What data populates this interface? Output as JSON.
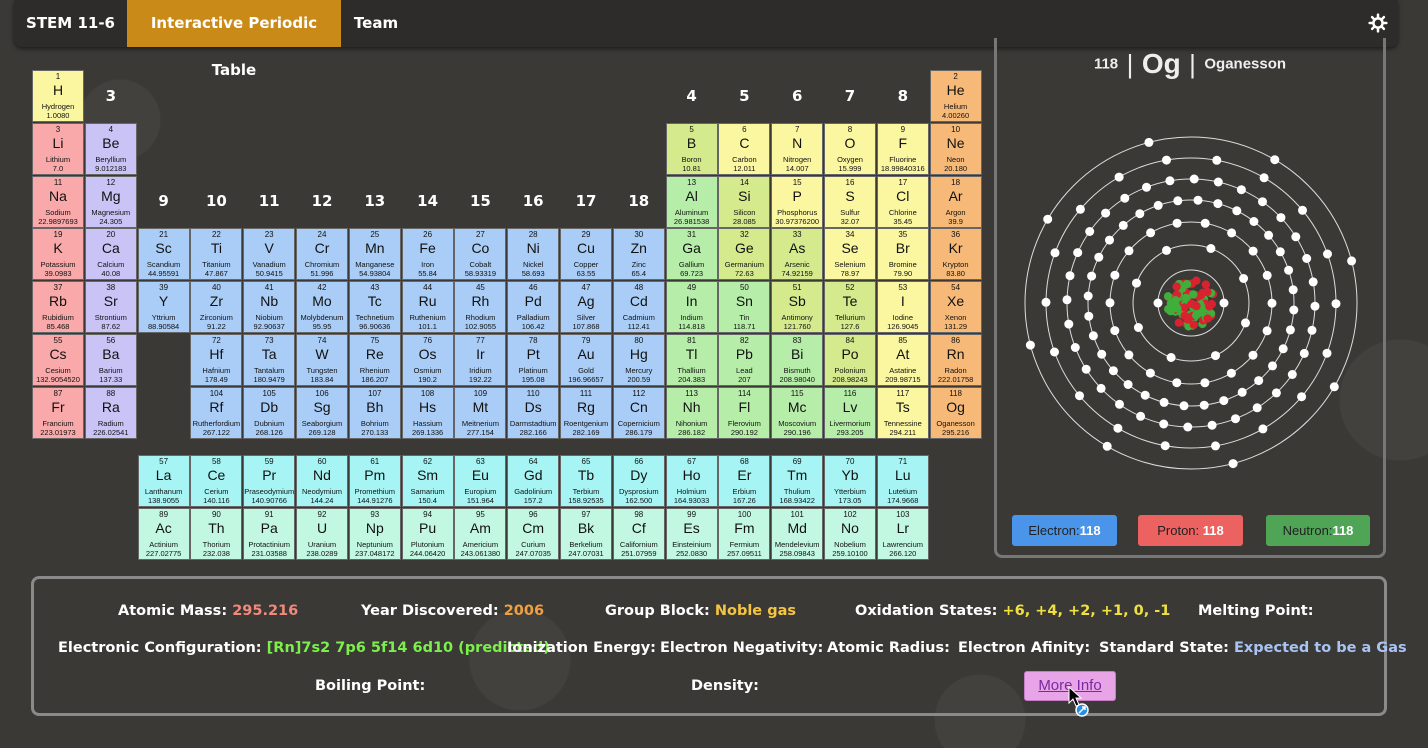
{
  "nav": {
    "items": [
      "STEM 11-6",
      "Interactive Periodic Table",
      "Team"
    ],
    "active_index": 1,
    "settings_icon": "gear-icon"
  },
  "group_labels": [
    {
      "label": "3"
    },
    {
      "label": "4"
    },
    {
      "label": "5"
    },
    {
      "label": "6"
    },
    {
      "label": "7"
    },
    {
      "label": "8"
    },
    {
      "label": "9"
    },
    {
      "label": "10"
    },
    {
      "label": "11"
    },
    {
      "label": "12"
    },
    {
      "label": "13"
    },
    {
      "label": "14"
    },
    {
      "label": "15"
    },
    {
      "label": "16"
    },
    {
      "label": "17"
    },
    {
      "label": "18"
    }
  ],
  "colors": {
    "alkali": "#f9a9a9",
    "alkaline": "#c9c3f6",
    "transition": "#a9cdf6",
    "post": "#b6eea9",
    "metalloid": "#d5e98d",
    "nonmetal": "#fbf6a0",
    "noble": "#f7b977",
    "hydrogen": "#fbf6a0",
    "lanthanide": "#a6f5f4",
    "actinide": "#c2f7e2",
    "unknown": "#cfe9a5"
  },
  "elements": [
    {
      "n": "1",
      "s": "H",
      "name": "Hydrogen",
      "m": "1.0080",
      "c": "hydrogen"
    },
    {
      "n": "2",
      "s": "He",
      "name": "Helium",
      "m": "4.00260",
      "c": "noble"
    },
    {
      "n": "3",
      "s": "Li",
      "name": "Lithium",
      "m": "7.0",
      "c": "alkali"
    },
    {
      "n": "4",
      "s": "Be",
      "name": "Beryllium",
      "m": "9.012183",
      "c": "alkaline"
    },
    {
      "n": "5",
      "s": "B",
      "name": "Boron",
      "m": "10.81",
      "c": "metalloid"
    },
    {
      "n": "6",
      "s": "C",
      "name": "Carbon",
      "m": "12.011",
      "c": "nonmetal"
    },
    {
      "n": "7",
      "s": "N",
      "name": "Nitrogen",
      "m": "14.007",
      "c": "nonmetal"
    },
    {
      "n": "8",
      "s": "O",
      "name": "Oxygen",
      "m": "15.999",
      "c": "nonmetal"
    },
    {
      "n": "9",
      "s": "F",
      "name": "Fluorine",
      "m": "18.99840316",
      "c": "nonmetal"
    },
    {
      "n": "10",
      "s": "Ne",
      "name": "Neon",
      "m": "20.180",
      "c": "noble"
    },
    {
      "n": "11",
      "s": "Na",
      "name": "Sodium",
      "m": "22.9897693",
      "c": "alkali"
    },
    {
      "n": "12",
      "s": "Mg",
      "name": "Magnesium",
      "m": "24.305",
      "c": "alkaline"
    },
    {
      "n": "13",
      "s": "Al",
      "name": "Aluminum",
      "m": "26.981538",
      "c": "post"
    },
    {
      "n": "14",
      "s": "Si",
      "name": "Silicon",
      "m": "28.085",
      "c": "metalloid"
    },
    {
      "n": "15",
      "s": "P",
      "name": "Phosphorus",
      "m": "30.97376200",
      "c": "nonmetal"
    },
    {
      "n": "16",
      "s": "S",
      "name": "Sulfur",
      "m": "32.07",
      "c": "nonmetal"
    },
    {
      "n": "17",
      "s": "Cl",
      "name": "Chlorine",
      "m": "35.45",
      "c": "nonmetal"
    },
    {
      "n": "18",
      "s": "Ar",
      "name": "Argon",
      "m": "39.9",
      "c": "noble"
    },
    {
      "n": "19",
      "s": "K",
      "name": "Potassium",
      "m": "39.0983",
      "c": "alkali"
    },
    {
      "n": "20",
      "s": "Ca",
      "name": "Calcium",
      "m": "40.08",
      "c": "alkaline"
    },
    {
      "n": "21",
      "s": "Sc",
      "name": "Scandium",
      "m": "44.95591",
      "c": "transition"
    },
    {
      "n": "22",
      "s": "Ti",
      "name": "Titanium",
      "m": "47.867",
      "c": "transition"
    },
    {
      "n": "23",
      "s": "V",
      "name": "Vanadium",
      "m": "50.9415",
      "c": "transition"
    },
    {
      "n": "24",
      "s": "Cr",
      "name": "Chromium",
      "m": "51.996",
      "c": "transition"
    },
    {
      "n": "25",
      "s": "Mn",
      "name": "Manganese",
      "m": "54.93804",
      "c": "transition"
    },
    {
      "n": "26",
      "s": "Fe",
      "name": "Iron",
      "m": "55.84",
      "c": "transition"
    },
    {
      "n": "27",
      "s": "Co",
      "name": "Cobalt",
      "m": "58.93319",
      "c": "transition"
    },
    {
      "n": "28",
      "s": "Ni",
      "name": "Nickel",
      "m": "58.693",
      "c": "transition"
    },
    {
      "n": "29",
      "s": "Cu",
      "name": "Copper",
      "m": "63.55",
      "c": "transition"
    },
    {
      "n": "30",
      "s": "Zn",
      "name": "Zinc",
      "m": "65.4",
      "c": "transition"
    },
    {
      "n": "31",
      "s": "Ga",
      "name": "Gallium",
      "m": "69.723",
      "c": "post"
    },
    {
      "n": "32",
      "s": "Ge",
      "name": "Germanium",
      "m": "72.63",
      "c": "metalloid"
    },
    {
      "n": "33",
      "s": "As",
      "name": "Arsenic",
      "m": "74.92159",
      "c": "metalloid"
    },
    {
      "n": "34",
      "s": "Se",
      "name": "Selenium",
      "m": "78.97",
      "c": "nonmetal"
    },
    {
      "n": "35",
      "s": "Br",
      "name": "Bromine",
      "m": "79.90",
      "c": "nonmetal"
    },
    {
      "n": "36",
      "s": "Kr",
      "name": "Krypton",
      "m": "83.80",
      "c": "noble"
    },
    {
      "n": "37",
      "s": "Rb",
      "name": "Rubidium",
      "m": "85.468",
      "c": "alkali"
    },
    {
      "n": "38",
      "s": "Sr",
      "name": "Strontium",
      "m": "87.62",
      "c": "alkaline"
    },
    {
      "n": "39",
      "s": "Y",
      "name": "Yttrium",
      "m": "88.90584",
      "c": "transition"
    },
    {
      "n": "40",
      "s": "Zr",
      "name": "Zirconium",
      "m": "91.22",
      "c": "transition"
    },
    {
      "n": "41",
      "s": "Nb",
      "name": "Niobium",
      "m": "92.90637",
      "c": "transition"
    },
    {
      "n": "42",
      "s": "Mo",
      "name": "Molybdenum",
      "m": "95.95",
      "c": "transition"
    },
    {
      "n": "43",
      "s": "Tc",
      "name": "Technetium",
      "m": "96.90636",
      "c": "transition"
    },
    {
      "n": "44",
      "s": "Ru",
      "name": "Ruthenium",
      "m": "101.1",
      "c": "transition"
    },
    {
      "n": "45",
      "s": "Rh",
      "name": "Rhodium",
      "m": "102.9055",
      "c": "transition"
    },
    {
      "n": "46",
      "s": "Pd",
      "name": "Palladium",
      "m": "106.42",
      "c": "transition"
    },
    {
      "n": "47",
      "s": "Ag",
      "name": "Silver",
      "m": "107.868",
      "c": "transition"
    },
    {
      "n": "48",
      "s": "Cd",
      "name": "Cadmium",
      "m": "112.41",
      "c": "transition"
    },
    {
      "n": "49",
      "s": "In",
      "name": "Indium",
      "m": "114.818",
      "c": "post"
    },
    {
      "n": "50",
      "s": "Sn",
      "name": "Tin",
      "m": "118.71",
      "c": "post"
    },
    {
      "n": "51",
      "s": "Sb",
      "name": "Antimony",
      "m": "121.760",
      "c": "metalloid"
    },
    {
      "n": "52",
      "s": "Te",
      "name": "Tellurium",
      "m": "127.6",
      "c": "metalloid"
    },
    {
      "n": "53",
      "s": "I",
      "name": "Iodine",
      "m": "126.9045",
      "c": "nonmetal"
    },
    {
      "n": "54",
      "s": "Xe",
      "name": "Xenon",
      "m": "131.29",
      "c": "noble"
    },
    {
      "n": "55",
      "s": "Cs",
      "name": "Cesium",
      "m": "132.9054520",
      "c": "alkali"
    },
    {
      "n": "56",
      "s": "Ba",
      "name": "Barium",
      "m": "137.33",
      "c": "alkaline"
    },
    {
      "n": "72",
      "s": "Hf",
      "name": "Hafnium",
      "m": "178.49",
      "c": "transition"
    },
    {
      "n": "73",
      "s": "Ta",
      "name": "Tantalum",
      "m": "180.9479",
      "c": "transition"
    },
    {
      "n": "74",
      "s": "W",
      "name": "Tungsten",
      "m": "183.84",
      "c": "transition"
    },
    {
      "n": "75",
      "s": "Re",
      "name": "Rhenium",
      "m": "186.207",
      "c": "transition"
    },
    {
      "n": "76",
      "s": "Os",
      "name": "Osmium",
      "m": "190.2",
      "c": "transition"
    },
    {
      "n": "77",
      "s": "Ir",
      "name": "Iridium",
      "m": "192.22",
      "c": "transition"
    },
    {
      "n": "78",
      "s": "Pt",
      "name": "Platinum",
      "m": "195.08",
      "c": "transition"
    },
    {
      "n": "79",
      "s": "Au",
      "name": "Gold",
      "m": "196.96657",
      "c": "transition"
    },
    {
      "n": "80",
      "s": "Hg",
      "name": "Mercury",
      "m": "200.59",
      "c": "transition"
    },
    {
      "n": "81",
      "s": "Tl",
      "name": "Thallium",
      "m": "204.383",
      "c": "post"
    },
    {
      "n": "82",
      "s": "Pb",
      "name": "Lead",
      "m": "207",
      "c": "post"
    },
    {
      "n": "83",
      "s": "Bi",
      "name": "Bismuth",
      "m": "208.98040",
      "c": "post"
    },
    {
      "n": "84",
      "s": "Po",
      "name": "Polonium",
      "m": "208.98243",
      "c": "metalloid"
    },
    {
      "n": "85",
      "s": "At",
      "name": "Astatine",
      "m": "209.98715",
      "c": "nonmetal"
    },
    {
      "n": "86",
      "s": "Rn",
      "name": "Radon",
      "m": "222.01758",
      "c": "noble"
    },
    {
      "n": "87",
      "s": "Fr",
      "name": "Francium",
      "m": "223.01973",
      "c": "alkali"
    },
    {
      "n": "88",
      "s": "Ra",
      "name": "Radium",
      "m": "226.02541",
      "c": "alkaline"
    },
    {
      "n": "104",
      "s": "Rf",
      "name": "Rutherfordium",
      "m": "267.122",
      "c": "transition"
    },
    {
      "n": "105",
      "s": "Db",
      "name": "Dubnium",
      "m": "268.126",
      "c": "transition"
    },
    {
      "n": "106",
      "s": "Sg",
      "name": "Seaborgium",
      "m": "269.128",
      "c": "transition"
    },
    {
      "n": "107",
      "s": "Bh",
      "name": "Bohrium",
      "m": "270.133",
      "c": "transition"
    },
    {
      "n": "108",
      "s": "Hs",
      "name": "Hassium",
      "m": "269.1336",
      "c": "transition"
    },
    {
      "n": "109",
      "s": "Mt",
      "name": "Meitnerium",
      "m": "277.154",
      "c": "transition"
    },
    {
      "n": "110",
      "s": "Ds",
      "name": "Darmstadtium",
      "m": "282.166",
      "c": "transition"
    },
    {
      "n": "111",
      "s": "Rg",
      "name": "Roentgenium",
      "m": "282.169",
      "c": "transition"
    },
    {
      "n": "112",
      "s": "Cn",
      "name": "Copernicium",
      "m": "286.179",
      "c": "transition"
    },
    {
      "n": "113",
      "s": "Nh",
      "name": "Nihonium",
      "m": "286.182",
      "c": "post"
    },
    {
      "n": "114",
      "s": "Fl",
      "name": "Flerovium",
      "m": "290.192",
      "c": "post"
    },
    {
      "n": "115",
      "s": "Mc",
      "name": "Moscovium",
      "m": "290.196",
      "c": "post"
    },
    {
      "n": "116",
      "s": "Lv",
      "name": "Livermorium",
      "m": "293.205",
      "c": "post"
    },
    {
      "n": "117",
      "s": "Ts",
      "name": "Tennessine",
      "m": "294.211",
      "c": "nonmetal"
    },
    {
      "n": "118",
      "s": "Og",
      "name": "Oganesson",
      "m": "295.216",
      "c": "noble"
    },
    {
      "n": "57",
      "s": "La",
      "name": "Lanthanum",
      "m": "138.9055",
      "c": "lanthanide"
    },
    {
      "n": "58",
      "s": "Ce",
      "name": "Cerium",
      "m": "140.116",
      "c": "lanthanide"
    },
    {
      "n": "59",
      "s": "Pr",
      "name": "Praseodymium",
      "m": "140.90766",
      "c": "lanthanide"
    },
    {
      "n": "60",
      "s": "Nd",
      "name": "Neodymium",
      "m": "144.24",
      "c": "lanthanide"
    },
    {
      "n": "61",
      "s": "Pm",
      "name": "Promethium",
      "m": "144.91276",
      "c": "lanthanide"
    },
    {
      "n": "62",
      "s": "Sm",
      "name": "Samarium",
      "m": "150.4",
      "c": "lanthanide"
    },
    {
      "n": "63",
      "s": "Eu",
      "name": "Europium",
      "m": "151.964",
      "c": "lanthanide"
    },
    {
      "n": "64",
      "s": "Gd",
      "name": "Gadolinium",
      "m": "157.2",
      "c": "lanthanide"
    },
    {
      "n": "65",
      "s": "Tb",
      "name": "Terbium",
      "m": "158.92535",
      "c": "lanthanide"
    },
    {
      "n": "66",
      "s": "Dy",
      "name": "Dysprosium",
      "m": "162.500",
      "c": "lanthanide"
    },
    {
      "n": "67",
      "s": "Ho",
      "name": "Holmium",
      "m": "164.93033",
      "c": "lanthanide"
    },
    {
      "n": "68",
      "s": "Er",
      "name": "Erbium",
      "m": "167.26",
      "c": "lanthanide"
    },
    {
      "n": "69",
      "s": "Tm",
      "name": "Thulium",
      "m": "168.93422",
      "c": "lanthanide"
    },
    {
      "n": "70",
      "s": "Yb",
      "name": "Ytterbium",
      "m": "173.05",
      "c": "lanthanide"
    },
    {
      "n": "71",
      "s": "Lu",
      "name": "Lutetium",
      "m": "174.9668",
      "c": "lanthanide"
    },
    {
      "n": "89",
      "s": "Ac",
      "name": "Actinium",
      "m": "227.02775",
      "c": "actinide"
    },
    {
      "n": "90",
      "s": "Th",
      "name": "Thorium",
      "m": "232.038",
      "c": "actinide"
    },
    {
      "n": "91",
      "s": "Pa",
      "name": "Protactinium",
      "m": "231.03588",
      "c": "actinide"
    },
    {
      "n": "92",
      "s": "U",
      "name": "Uranium",
      "m": "238.0289",
      "c": "actinide"
    },
    {
      "n": "93",
      "s": "Np",
      "name": "Neptunium",
      "m": "237.048172",
      "c": "actinide"
    },
    {
      "n": "94",
      "s": "Pu",
      "name": "Plutonium",
      "m": "244.06420",
      "c": "actinide"
    },
    {
      "n": "95",
      "s": "Am",
      "name": "Americium",
      "m": "243.061380",
      "c": "actinide"
    },
    {
      "n": "96",
      "s": "Cm",
      "name": "Curium",
      "m": "247.07035",
      "c": "actinide"
    },
    {
      "n": "97",
      "s": "Bk",
      "name": "Berkelium",
      "m": "247.07031",
      "c": "actinide"
    },
    {
      "n": "98",
      "s": "Cf",
      "name": "Californium",
      "m": "251.07959",
      "c": "actinide"
    },
    {
      "n": "99",
      "s": "Es",
      "name": "Einsteinium",
      "m": "252.0830",
      "c": "actinide"
    },
    {
      "n": "100",
      "s": "Fm",
      "name": "Fermium",
      "m": "257.09511",
      "c": "actinide"
    },
    {
      "n": "101",
      "s": "Md",
      "name": "Mendelevium",
      "m": "258.09843",
      "c": "actinide"
    },
    {
      "n": "102",
      "s": "No",
      "name": "Nobelium",
      "m": "259.10100",
      "c": "actinide"
    },
    {
      "n": "103",
      "s": "Lr",
      "name": "Lawrencium",
      "m": "266.120",
      "c": "actinide"
    }
  ],
  "selected": {
    "number": "118",
    "separator": "|",
    "symbol": "Og",
    "name": "Oganesson",
    "shells": [
      2,
      8,
      18,
      32,
      32,
      18,
      8
    ],
    "counts": {
      "electron_label": "Electron:",
      "electron": "118",
      "proton_label": "Proton:",
      "proton": "118",
      "neutron_label": "Neutron:",
      "neutron": "118"
    }
  },
  "info": {
    "atomic_mass_label": "Atomic Mass:",
    "atomic_mass": "295.216",
    "year_label": "Year Discovered:",
    "year": "2006",
    "group_block_label": "Group Block:",
    "group_block": "Noble gas",
    "oxidation_label": "Oxidation States:",
    "oxidation": "+6, +4, +2, +1, 0, -1",
    "melting_label": "Melting Point:",
    "config_label": "Electronic Configuration:",
    "config": "[Rn]7s2 7p6 5f14 6d10 (predicted)",
    "ionization_label": "Ionization Energy:",
    "negativity_label": "Electron Negativity:",
    "radius_label": "Atomic Radius:",
    "affinity_label": "Electron Afinity:",
    "state_label": "Standard State:",
    "state": "Expected to be a Gas",
    "boiling_label": "Boiling Point:",
    "density_label": "Density:",
    "more_info": "More Info",
    "colors": {
      "atomic_mass": "#f08a7a",
      "year": "#f0a040",
      "group_block": "#f5c542",
      "oxidation": "#f0e040",
      "config": "#7cf04a",
      "state": "#a9c4f4"
    }
  }
}
